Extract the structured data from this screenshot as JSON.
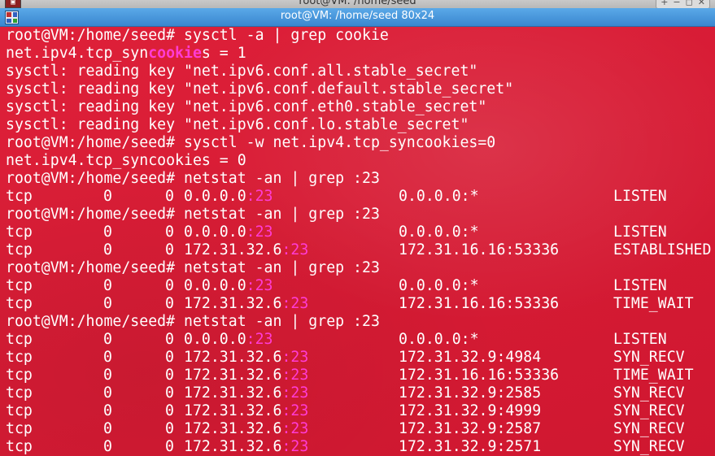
{
  "window": {
    "outer_title": "root@VM: /home/seed",
    "title": "root@VM: /home/seed 80x24",
    "controls": [
      "+",
      "−",
      "◻",
      "✕"
    ]
  },
  "terminal": {
    "lines": [
      {
        "type": "cmd",
        "prompt": "root@VM:/home/seed#",
        "command": "sysctl -a | grep cookie"
      },
      {
        "type": "match",
        "pre": "net.ipv4.tcp_syn",
        "match": "cookie",
        "post": "s = 1"
      },
      {
        "type": "text",
        "text": "sysctl: reading key \"net.ipv6.conf.all.stable_secret\""
      },
      {
        "type": "text",
        "text": "sysctl: reading key \"net.ipv6.conf.default.stable_secret\""
      },
      {
        "type": "text",
        "text": "sysctl: reading key \"net.ipv6.conf.eth0.stable_secret\""
      },
      {
        "type": "text",
        "text": "sysctl: reading key \"net.ipv6.conf.lo.stable_secret\""
      },
      {
        "type": "cmd",
        "prompt": "root@VM:/home/seed#",
        "command": "sysctl -w net.ipv4.tcp_syncookies=0"
      },
      {
        "type": "text",
        "text": "net.ipv4.tcp_syncookies = 0"
      },
      {
        "type": "cmd",
        "prompt": "root@VM:/home/seed#",
        "command": "netstat -an | grep :23"
      },
      {
        "type": "net",
        "proto": "tcp",
        "recvq": "0",
        "sendq": "0",
        "local_ip": "0.0.0.0",
        "local_port": ":23",
        "foreign": "0.0.0.0:*",
        "state": "LISTEN"
      },
      {
        "type": "cmd",
        "prompt": "root@VM:/home/seed#",
        "command": "netstat -an | grep :23"
      },
      {
        "type": "net",
        "proto": "tcp",
        "recvq": "0",
        "sendq": "0",
        "local_ip": "0.0.0.0",
        "local_port": ":23",
        "foreign": "0.0.0.0:*",
        "state": "LISTEN"
      },
      {
        "type": "net",
        "proto": "tcp",
        "recvq": "0",
        "sendq": "0",
        "local_ip": "172.31.32.6",
        "local_port": ":23",
        "foreign": "172.31.16.16:53336",
        "state": "ESTABLISHED"
      },
      {
        "type": "cmd",
        "prompt": "root@VM:/home/seed#",
        "command": "netstat -an | grep :23"
      },
      {
        "type": "net",
        "proto": "tcp",
        "recvq": "0",
        "sendq": "0",
        "local_ip": "0.0.0.0",
        "local_port": ":23",
        "foreign": "0.0.0.0:*",
        "state": "LISTEN"
      },
      {
        "type": "net",
        "proto": "tcp",
        "recvq": "0",
        "sendq": "0",
        "local_ip": "172.31.32.6",
        "local_port": ":23",
        "foreign": "172.31.16.16:53336",
        "state": "TIME_WAIT"
      },
      {
        "type": "cmd",
        "prompt": "root@VM:/home/seed#",
        "command": "netstat -an | grep :23"
      },
      {
        "type": "net",
        "proto": "tcp",
        "recvq": "0",
        "sendq": "0",
        "local_ip": "0.0.0.0",
        "local_port": ":23",
        "foreign": "0.0.0.0:*",
        "state": "LISTEN"
      },
      {
        "type": "net",
        "proto": "tcp",
        "recvq": "0",
        "sendq": "0",
        "local_ip": "172.31.32.6",
        "local_port": ":23",
        "foreign": "172.31.32.9:4984",
        "state": "SYN_RECV"
      },
      {
        "type": "net",
        "proto": "tcp",
        "recvq": "0",
        "sendq": "0",
        "local_ip": "172.31.32.6",
        "local_port": ":23",
        "foreign": "172.31.16.16:53336",
        "state": "TIME_WAIT"
      },
      {
        "type": "net",
        "proto": "tcp",
        "recvq": "0",
        "sendq": "0",
        "local_ip": "172.31.32.6",
        "local_port": ":23",
        "foreign": "172.31.32.9:2585",
        "state": "SYN_RECV"
      },
      {
        "type": "net",
        "proto": "tcp",
        "recvq": "0",
        "sendq": "0",
        "local_ip": "172.31.32.6",
        "local_port": ":23",
        "foreign": "172.31.32.9:4999",
        "state": "SYN_RECV"
      },
      {
        "type": "net",
        "proto": "tcp",
        "recvq": "0",
        "sendq": "0",
        "local_ip": "172.31.32.6",
        "local_port": ":23",
        "foreign": "172.31.32.9:2587",
        "state": "SYN_RECV"
      },
      {
        "type": "net",
        "proto": "tcp",
        "recvq": "0",
        "sendq": "0",
        "local_ip": "172.31.32.6",
        "local_port": ":23",
        "foreign": "172.31.32.9:2571",
        "state": "SYN_RECV"
      }
    ]
  },
  "colors": {
    "background": "#d81b35",
    "text": "#ffffff",
    "grep_highlight": "#ff3cd4",
    "titlebar": "#4a98dc"
  },
  "icons": {
    "app_icon": "terminal-app-icon",
    "window_menu_icon": "window-menu-icon"
  }
}
